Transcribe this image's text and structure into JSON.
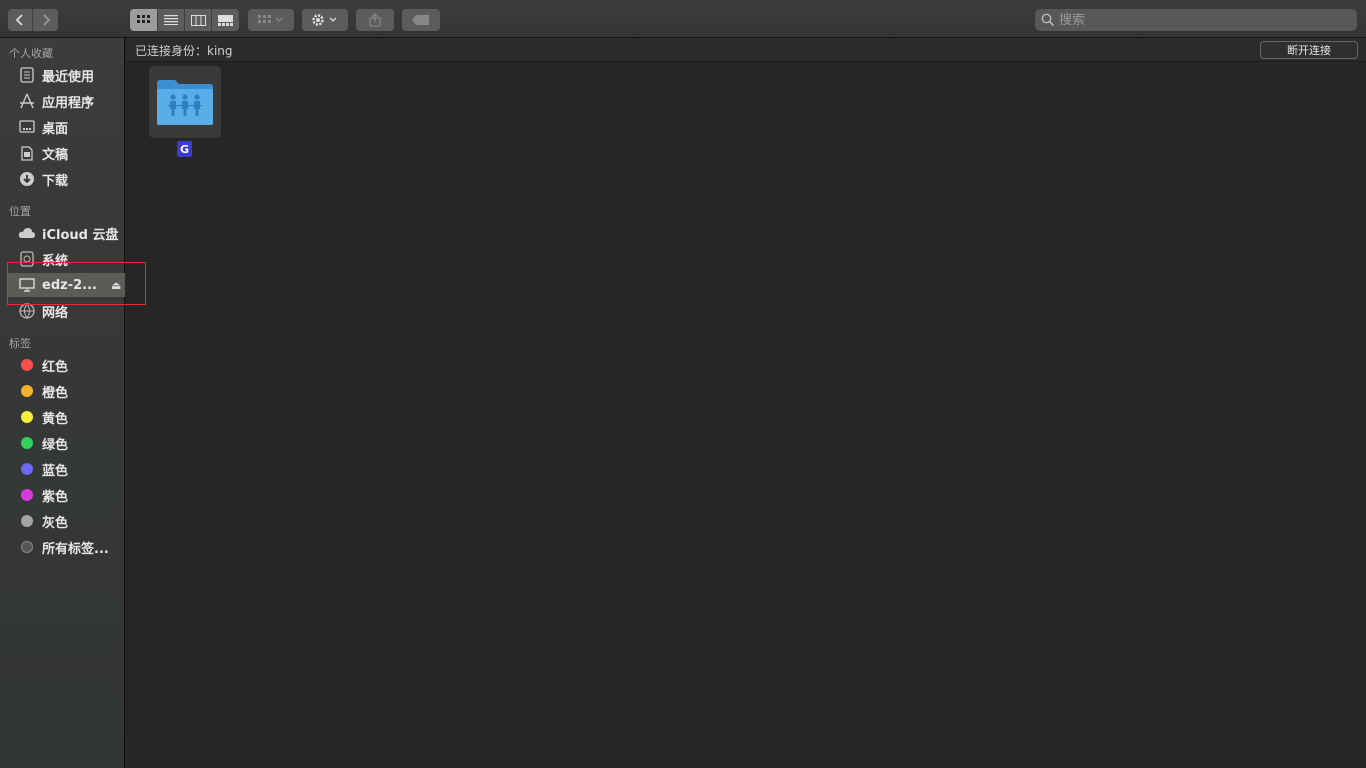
{
  "toolbar": {
    "back_icon": "chevron-left-icon",
    "forward_icon": "chevron-right-icon",
    "view_modes": [
      "icon-view",
      "list-view",
      "column-view",
      "gallery-view"
    ],
    "search_placeholder": "搜索"
  },
  "sidebar": {
    "favorites_title": "个人收藏",
    "favorites": [
      {
        "label": "最近使用",
        "icon": "recents-icon"
      },
      {
        "label": "应用程序",
        "icon": "applications-icon"
      },
      {
        "label": "桌面",
        "icon": "desktop-icon"
      },
      {
        "label": "文稿",
        "icon": "documents-icon"
      },
      {
        "label": "下载",
        "icon": "downloads-icon"
      }
    ],
    "locations_title": "位置",
    "locations": [
      {
        "label": "iCloud 云盘",
        "icon": "cloud-icon"
      },
      {
        "label": "系统",
        "icon": "disk-icon"
      },
      {
        "label": "edz-2...",
        "icon": "computer-icon",
        "selected": true
      },
      {
        "label": "网络",
        "icon": "network-icon"
      }
    ],
    "tags_title": "标签",
    "tags": [
      {
        "label": "红色",
        "color": "#fc4f4d"
      },
      {
        "label": "橙色",
        "color": "#f7b42b"
      },
      {
        "label": "黄色",
        "color": "#fbef3a"
      },
      {
        "label": "绿色",
        "color": "#30d25a"
      },
      {
        "label": "蓝色",
        "color": "#6d67f6"
      },
      {
        "label": "紫色",
        "color": "#d93ae0"
      },
      {
        "label": "灰色",
        "color": "#a4a4a4"
      },
      {
        "label": "所有标签...",
        "color": "#777777"
      }
    ]
  },
  "main": {
    "connection_text": "已连接身份：king",
    "disconnect_label": "断开连接",
    "folder": {
      "label": "G",
      "icon": "shared-folder-icon"
    }
  }
}
